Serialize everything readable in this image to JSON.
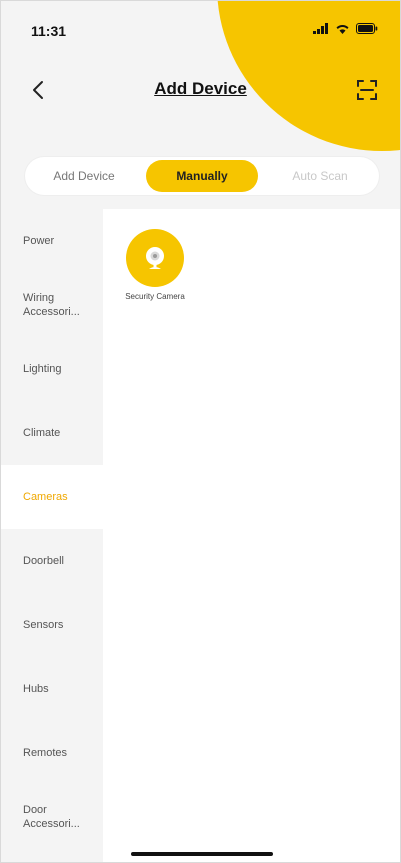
{
  "status_bar": {
    "time": "11:31"
  },
  "header": {
    "title": "Add Device",
    "back_icon": "chevron-left-icon",
    "scan_icon": "scan-icon"
  },
  "tabs": [
    {
      "label": "Add Device",
      "state": "inactive"
    },
    {
      "label": "Manually",
      "state": "active"
    },
    {
      "label": "Auto Scan",
      "state": "disabled"
    }
  ],
  "sidebar": {
    "items": [
      {
        "label": "Power"
      },
      {
        "label": "Wiring Accessori..."
      },
      {
        "label": "Lighting"
      },
      {
        "label": "Climate"
      },
      {
        "label": "Cameras",
        "active": true
      },
      {
        "label": "Doorbell"
      },
      {
        "label": "Sensors"
      },
      {
        "label": "Hubs"
      },
      {
        "label": "Remotes"
      },
      {
        "label": "Door Accessori..."
      }
    ]
  },
  "devices": [
    {
      "label": "Security Camera",
      "icon": "camera-icon"
    }
  ],
  "colors": {
    "accent": "#f6c500",
    "active_text": "#f0a800",
    "background": "#f4f4f4"
  }
}
